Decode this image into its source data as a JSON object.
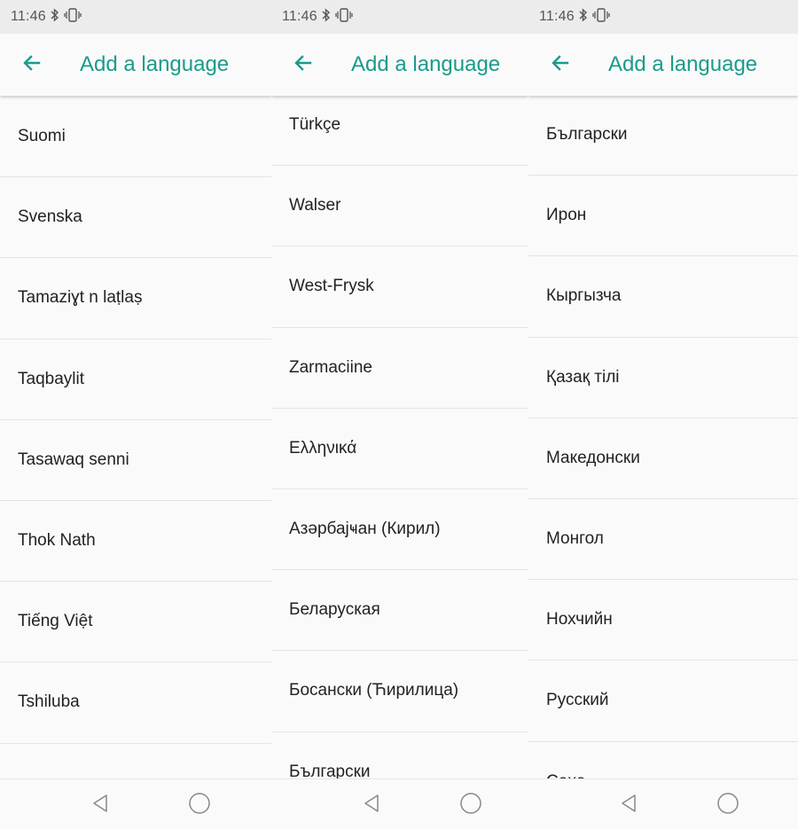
{
  "status": {
    "time": "11:46"
  },
  "appbar": {
    "title": "Add a language"
  },
  "screens": [
    {
      "items": [
        "Suomi",
        "Svenska",
        "Tamaziɣt n laṭlaṣ",
        "Taqbaylit",
        "Tasawaq senni",
        "Thok Nath",
        "Tiếng Việt",
        "Tshiluba",
        ""
      ]
    },
    {
      "items": [
        "Türkçe",
        "Walser",
        "West-Frysk",
        "Zarmaciine",
        "Ελληνικά",
        "Азәрбајҹан (Кирил)",
        "Беларуская",
        "Босански (Ћирилица)",
        "Български"
      ]
    },
    {
      "items": [
        "Български",
        "Ирон",
        "Кыргызча",
        "Қазақ тілі",
        "Македонски",
        "Монгол",
        "Нохчийн",
        "Русский",
        "Сахa"
      ]
    }
  ],
  "icons": {
    "back": "arrow-left-icon",
    "nav_back": "triangle-back-icon",
    "nav_home": "circle-home-icon"
  },
  "colors": {
    "accent": "#1a9b8a"
  }
}
